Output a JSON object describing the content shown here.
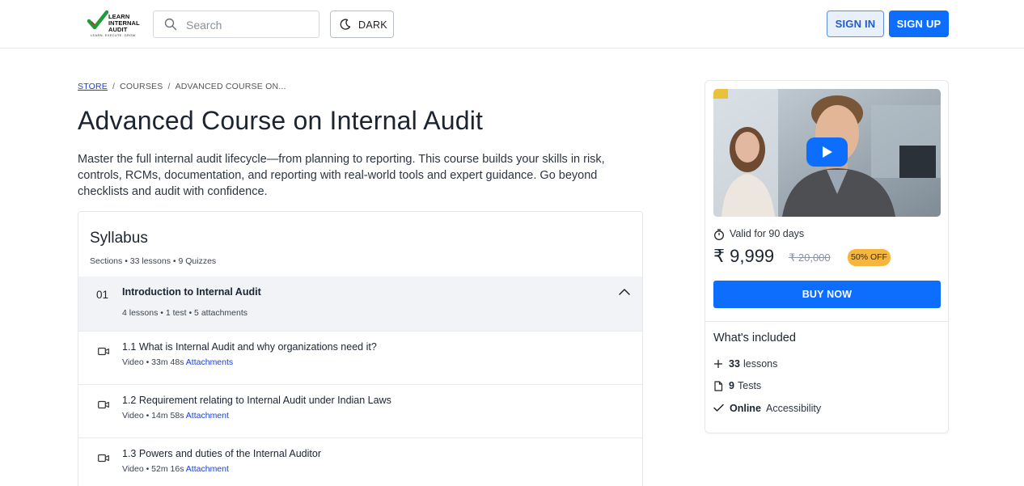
{
  "header": {
    "logo": {
      "line1": "LEARN",
      "line2": "INTERNAL",
      "line3": "AUDIT",
      "tagline": "LEARN. EXECUTE. GROW."
    },
    "search_placeholder": "Search",
    "dark_label": "DARK",
    "signin_label": "SIGN IN",
    "signup_label": "SIGN UP"
  },
  "breadcrumb": {
    "items": [
      "STORE",
      "COURSES",
      "ADVANCED COURSE ON..."
    ],
    "separator": "/"
  },
  "course": {
    "title": "Advanced Course on Internal Audit",
    "description": "Master the full internal audit lifecycle—from planning to reporting. This course builds your skills in risk, controls, RCMs, documentation, and reporting with real-world tools and expert guidance. Go beyond checklists and audit with confidence."
  },
  "syllabus": {
    "title": "Syllabus",
    "meta": "Sections • 33 lessons • 9 Quizzes",
    "sections": [
      {
        "number": "01",
        "title": "Introduction to Internal Audit",
        "meta": "4 lessons • 1 test • 5 attachments",
        "lessons": [
          {
            "title": "1.1 What is Internal Audit and why organizations need it?",
            "meta": "Video • 33m 48s",
            "attachment": "Attachments"
          },
          {
            "title": "1.2 Requirement relating to Internal Audit under Indian Laws",
            "meta": "Video • 14m 58s",
            "attachment": "Attachment"
          },
          {
            "title": "1.3 Powers and duties of the Internal Auditor",
            "meta": "Video • 52m 16s",
            "attachment": "Attachment"
          }
        ]
      }
    ]
  },
  "card": {
    "validity": "Valid for 90 days",
    "price": "₹ 9,999",
    "old_price": "₹ 20,000",
    "discount": "50% OFF",
    "buy_label": "BUY NOW",
    "included_title": "What's included",
    "included": [
      {
        "icon": "plus-icon",
        "count": "33",
        "label": "lessons"
      },
      {
        "icon": "document-icon",
        "count": "9",
        "label": "Tests"
      },
      {
        "icon": "check-icon",
        "count": "Online",
        "label": "Accessibility"
      }
    ]
  },
  "colors": {
    "primary": "#0d6efd",
    "badge": "#f6b53b",
    "link": "#1a3fd6",
    "logo_green": "#1f9d3a"
  }
}
